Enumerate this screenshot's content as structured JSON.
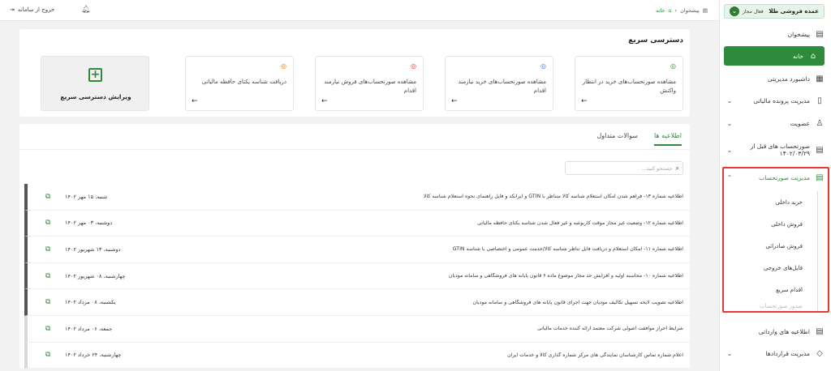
{
  "header": {
    "logout_label": "خروج از سامانه",
    "breadcrumb": [
      "پیشخوان",
      "خانه"
    ]
  },
  "sidebar": {
    "org_name": "عمده فروشی طلا",
    "org_status": "فعال مجاز",
    "items": [
      {
        "label": "پیشخوان",
        "icon": "dashboard-icon"
      },
      {
        "label": "خانه",
        "icon": "home-icon"
      },
      {
        "label": "داشبورد مدیریتی",
        "icon": "grid-icon"
      },
      {
        "label": "مدیریت پرونده مالیاتی",
        "icon": "file-icon"
      },
      {
        "label": "عضویت",
        "icon": "user-icon"
      },
      {
        "label": "صورتحساب های قبل از ۱۴۰۲/۰۳/۲۹",
        "icon": "receipt-icon"
      },
      {
        "label": "مدیریت صورتحساب",
        "icon": "invoice-icon"
      },
      {
        "label": "اطلاعیه های وارداتی",
        "icon": "notice-icon"
      },
      {
        "label": "مدیریت قراردادها",
        "icon": "contract-icon"
      }
    ],
    "submenu": [
      "خرید داخلی",
      "فروش داخلی",
      "فروش صادراتی",
      "فایل‌های خروجی",
      "اقدام سریع",
      "صدور صورتحساب"
    ]
  },
  "quick_access": {
    "title": "دسترسی سریع",
    "cards": [
      {
        "text": "مشاهده صورتحساب‌های خرید در انتظار واکنش",
        "color": "#2e8b3e"
      },
      {
        "text": "مشاهده صورتحساب‌های خرید نیازمند اقدام",
        "color": "#3a7bd5"
      },
      {
        "text": "مشاهده صورتحساب‌های فروش نیازمند اقدام",
        "color": "#e53935"
      },
      {
        "text": "دریافت شناسه یکتای حافظه مالیاتی",
        "color": "#f57c00"
      }
    ],
    "edit_label": "ویرایش دسترسی سریع"
  },
  "announcements": {
    "tabs": [
      "اطلاعیه ها",
      "سوالات متداول"
    ],
    "search_placeholder": "جستجو کنید...",
    "rows": [
      {
        "title": "اطلاعیه شماره ۱۳- فراهم شدن امکان استعلام شناسه کالا متناظر با GTIN و ایرانکد و فایل راهنمای نحوه استعلام شناسه کالا",
        "date": "شنبه، ۱۵ مهر ۱۴۰۲"
      },
      {
        "title": "اطلاعیه شماره ۱۲- وضعیت غیر مجاز موقت کاربوشه و غیر فعال شدن شناسه یکتای حافظه مالیاتی",
        "date": "دوشنبه، ۰۳ مهر ۱۴۰۲"
      },
      {
        "title": "اطلاعیه شماره ۱۱- امکان استعلام و دریافت فایل تناظر شناسه کالا/خدمت عمومی و اختصاصی با شناسه GTIN",
        "date": "دوشنبه، ۱۳ شهریور ۱۴۰۲"
      },
      {
        "title": "اطلاعیه شماره ۱۰- محاسبه اولیه و افزایش حد مجاز موضوع ماده ۶ قانون پایانه های فروشگاهی و سامانه مودیان",
        "date": "چهارشنبه، ۰۸ شهریور ۱۴۰۲"
      },
      {
        "title": "اطلاعیه تصویب لایحه تسهیل تکالیف مودیان جهت اجرای قانون پایانه های فروشگاهی و سامانه مودیان",
        "date": "یکشنبه، ۰۸ مرداد ۱۴۰۲"
      },
      {
        "title": "شرایط احراز موافقت اصولی شرکت معتمد ارائه کننده خدمات مالیاتی",
        "date": "جمعه، ۰۶ مرداد ۱۴۰۲"
      },
      {
        "title": "اعلام شماره تماس کارشناسان نمایندگی های مرکز شماره گذاری کالا و خدمات ایران",
        "date": "چهارشنبه، ۲۴ خرداد ۱۴۰۲"
      }
    ]
  }
}
